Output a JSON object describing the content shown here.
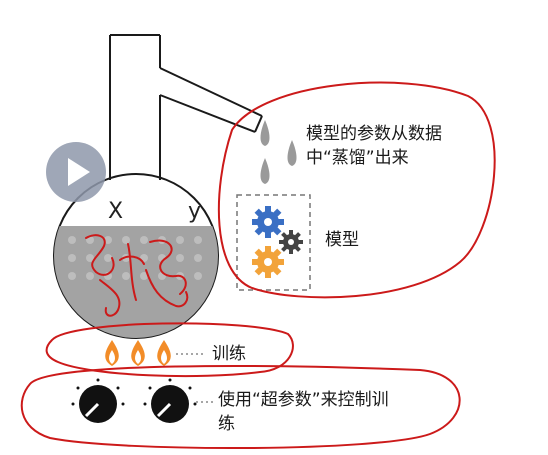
{
  "flask": {
    "var_x": "X",
    "var_y": "y"
  },
  "labels": {
    "output_line1": "模型的参数从数据",
    "output_line2": "中“蒸馏”出来",
    "model": "模型",
    "training": "训练",
    "hyper_line1": "使用“超参数”来控制训",
    "hyper_line2": "练"
  },
  "colors": {
    "annotation_red": "#cc1a1a",
    "liquid": "#a3a3a3",
    "gear_blue": "#3a6fc4",
    "gear_gray": "#444444",
    "gear_orange": "#f2a33a",
    "flame_orange": "#f28c28",
    "drop_gray": "#9a9a9a",
    "play_button": "#8e98aa"
  },
  "icons": [
    "play-icon",
    "droplet-icon",
    "gear-icon",
    "flame-icon",
    "knob-icon"
  ]
}
